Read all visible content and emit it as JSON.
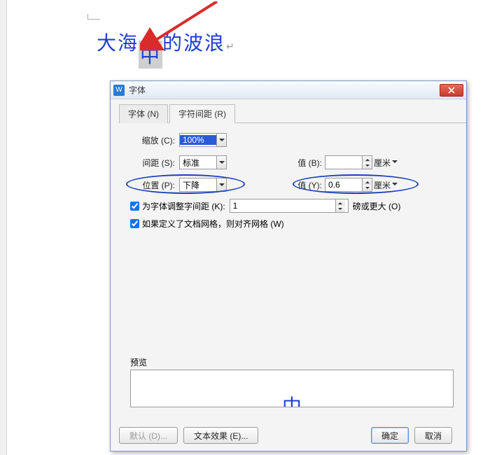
{
  "document": {
    "before": "大海",
    "shifted": "中",
    "after": "的波浪",
    "parabreak": "↵"
  },
  "dialog": {
    "app_icon_letter": "W",
    "title": "字体",
    "tabs": {
      "font": "字体 (N)",
      "spacing": "字符间距 (R)"
    },
    "scale_label": "缩放 (C):",
    "scale_value": "100%",
    "spacing_label": "间距 (S):",
    "spacing_value": "标准",
    "spacing_by_label": "值 (B):",
    "spacing_by_value": "",
    "spacing_by_unit": "厘米",
    "position_label": "位置 (P):",
    "position_value": "下降",
    "position_by_label": "值 (Y):",
    "position_by_value": "0.6",
    "position_by_unit": "厘米",
    "kerning_checkbox": "为字体调整字间距 (K):",
    "kerning_value": "1",
    "kerning_trail": "磅或更大 (O)",
    "grid_checkbox": "如果定义了文档网格，则对齐网格 (W)",
    "preview_label": "预览",
    "preview_char": "中",
    "buttons": {
      "default": "默认 (D)...",
      "effects": "文本效果 (E)...",
      "ok": "确定",
      "cancel": "取消"
    }
  }
}
